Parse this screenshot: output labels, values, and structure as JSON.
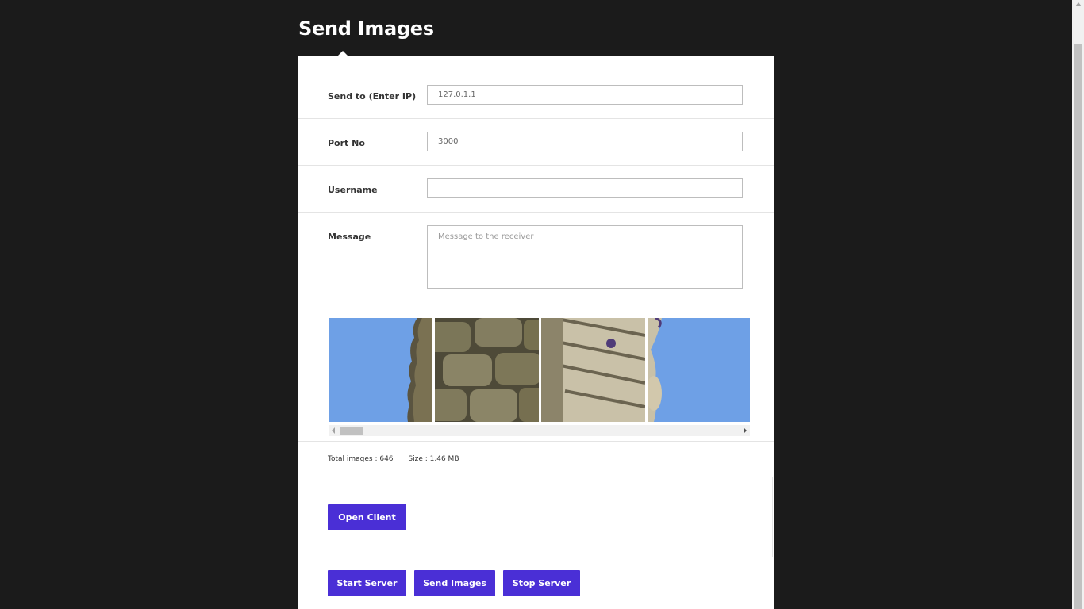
{
  "page": {
    "title": "Send Images"
  },
  "form": {
    "ip": {
      "label": "Send to (Enter IP)",
      "value": "127.0.1.1"
    },
    "port": {
      "label": "Port No",
      "value": "3000"
    },
    "username": {
      "label": "Username",
      "value": ""
    },
    "message": {
      "label": "Message",
      "placeholder": "Message to the receiver"
    }
  },
  "gallery": {
    "images": [
      {
        "name": "image-sky-rock-left"
      },
      {
        "name": "image-stone-wall"
      },
      {
        "name": "image-stone-column"
      },
      {
        "name": "image-sky-rock-right"
      }
    ]
  },
  "stats": {
    "total_images": "Total images : 646",
    "size": "Size : 1.46 MB"
  },
  "buttons": {
    "open_client": "Open Client",
    "start_server": "Start Server",
    "send_images": "Send Images",
    "stop_server": "Stop Server"
  },
  "colors": {
    "background": "#1b1b1b",
    "accent": "#4a2fd6",
    "card": "#ffffff"
  }
}
